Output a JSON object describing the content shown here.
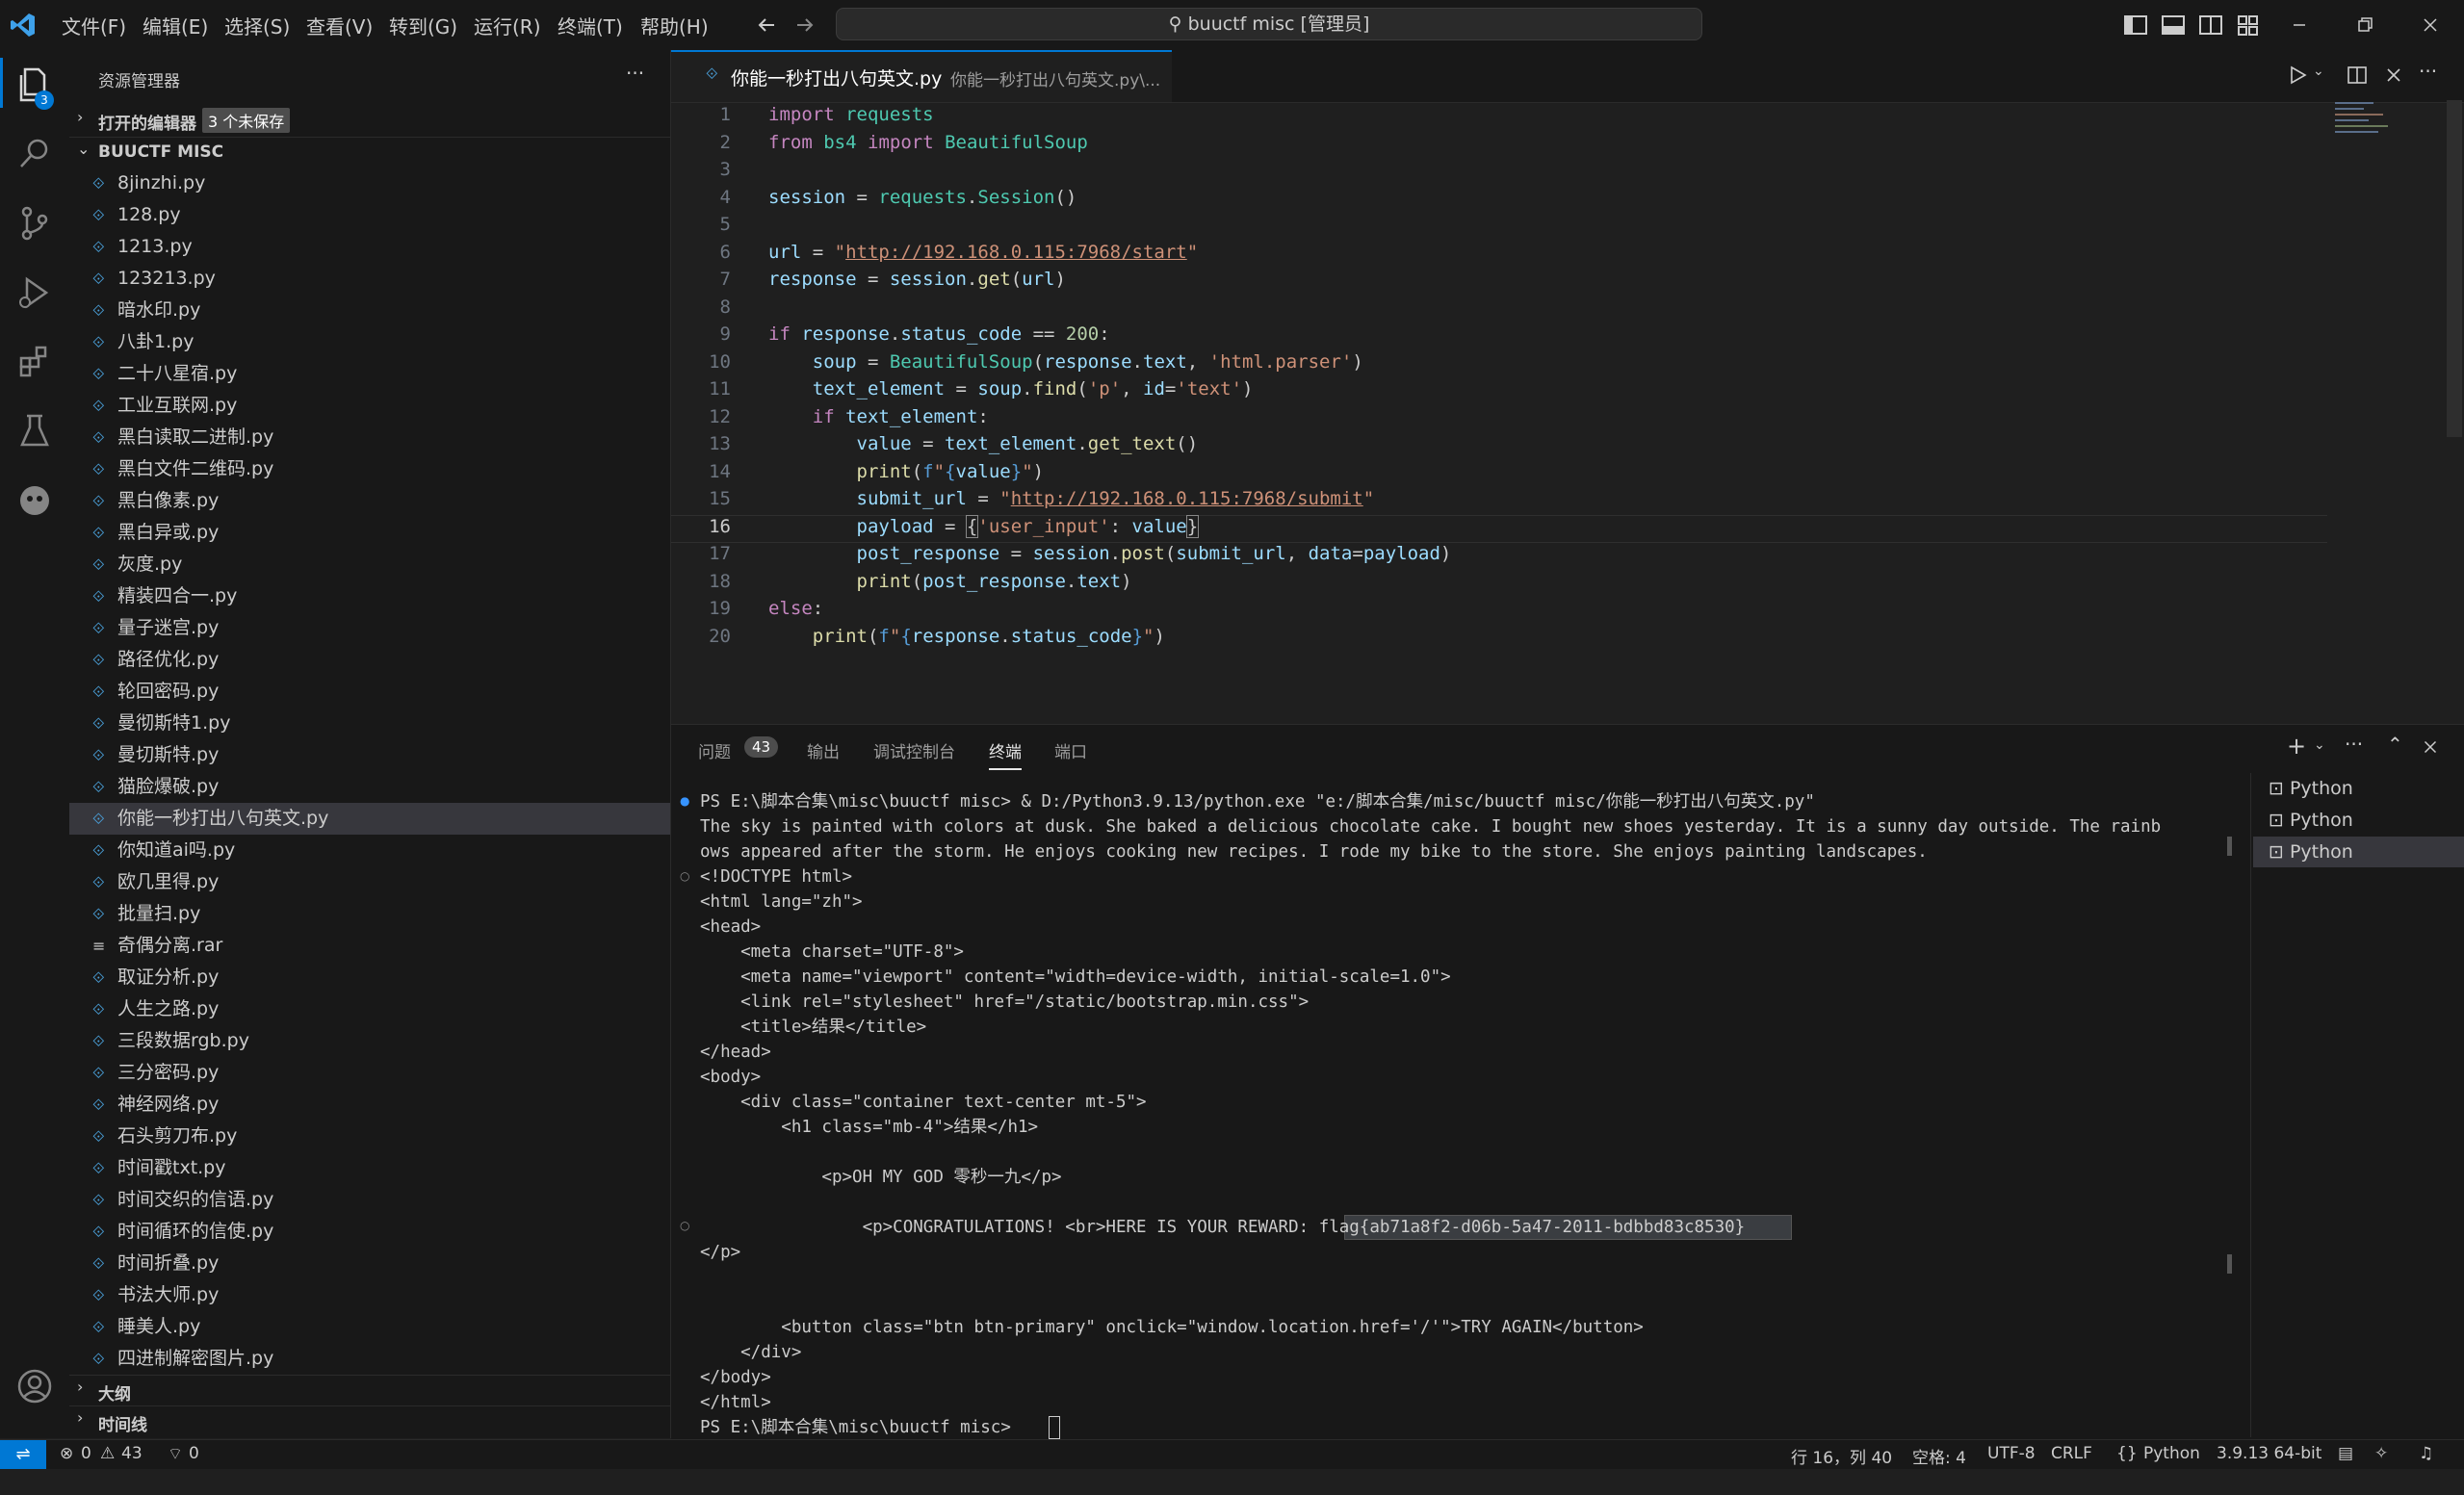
{
  "menu": [
    "文件(F)",
    "编辑(E)",
    "选择(S)",
    "查看(V)",
    "转到(G)",
    "运行(R)",
    "终端(T)",
    "帮助(H)"
  ],
  "search_box_text": "buuctf misc [管理员]",
  "activity_badge": "3",
  "sidebar": {
    "title": "资源管理器",
    "open_editors_label": "打开的编辑器",
    "open_editors_badge": "3 个未保存",
    "folder_name": "BUUCTF MISC",
    "files": [
      {
        "name": "8jinzhi.py",
        "icon": "py"
      },
      {
        "name": "128.py",
        "icon": "py"
      },
      {
        "name": "1213.py",
        "icon": "py"
      },
      {
        "name": "123213.py",
        "icon": "py"
      },
      {
        "name": "暗水印.py",
        "icon": "py"
      },
      {
        "name": "八卦1.py",
        "icon": "py"
      },
      {
        "name": "二十八星宿.py",
        "icon": "py"
      },
      {
        "name": "工业互联网.py",
        "icon": "py"
      },
      {
        "name": "黑白读取二进制.py",
        "icon": "py"
      },
      {
        "name": "黑白文件二维码.py",
        "icon": "py"
      },
      {
        "name": "黑白像素.py",
        "icon": "py"
      },
      {
        "name": "黑白异或.py",
        "icon": "py"
      },
      {
        "name": "灰度.py",
        "icon": "py"
      },
      {
        "name": "精装四合一.py",
        "icon": "py"
      },
      {
        "name": "量子迷宫.py",
        "icon": "py"
      },
      {
        "name": "路径优化.py",
        "icon": "py"
      },
      {
        "name": "轮回密码.py",
        "icon": "py"
      },
      {
        "name": "曼彻斯特1.py",
        "icon": "py"
      },
      {
        "name": "曼切斯特.py",
        "icon": "py"
      },
      {
        "name": "猫脸爆破.py",
        "icon": "py"
      },
      {
        "name": "你能一秒打出八句英文.py",
        "icon": "py"
      },
      {
        "name": "你知道ai吗.py",
        "icon": "py"
      },
      {
        "name": "欧几里得.py",
        "icon": "py"
      },
      {
        "name": "批量扫.py",
        "icon": "py"
      },
      {
        "name": "奇偶分离.rar",
        "icon": "rar"
      },
      {
        "name": "取证分析.py",
        "icon": "py"
      },
      {
        "name": "人生之路.py",
        "icon": "py"
      },
      {
        "name": "三段数据rgb.py",
        "icon": "py"
      },
      {
        "name": "三分密码.py",
        "icon": "py"
      },
      {
        "name": "神经网络.py",
        "icon": "py"
      },
      {
        "name": "石头剪刀布.py",
        "icon": "py"
      },
      {
        "name": "时间戳txt.py",
        "icon": "py"
      },
      {
        "name": "时间交织的信语.py",
        "icon": "py"
      },
      {
        "name": "时间循环的信使.py",
        "icon": "py"
      },
      {
        "name": "时间折叠.py",
        "icon": "py"
      },
      {
        "name": "书法大师.py",
        "icon": "py"
      },
      {
        "name": "睡美人.py",
        "icon": "py"
      },
      {
        "name": "四进制解密图片.py",
        "icon": "py"
      }
    ],
    "selected_file": "你能一秒打出八句英文.py",
    "outline_label": "大纲",
    "timeline_label": "时间线"
  },
  "editor": {
    "tab_title": "你能一秒打出八句英文.py",
    "breadcrumb": "你能一秒打出八句英文.py\\...",
    "current_line": "16",
    "line_numbers": [
      "1",
      "2",
      "3",
      "4",
      "5",
      "6",
      "7",
      "8",
      "9",
      "10",
      "11",
      "12",
      "13",
      "14",
      "15",
      "16",
      "17",
      "18",
      "19",
      "20"
    ]
  },
  "panel": {
    "tabs": [
      "问题",
      "输出",
      "调试控制台",
      "终端",
      "端口"
    ],
    "problems_count": "43",
    "active_tab": "终端",
    "terminal_lines": [
      "PS E:\\脚本合集\\misc\\buuctf misc> & D:/Python3.9.13/python.exe \"e:/脚本合集/misc/buuctf misc/你能一秒打出八句英文.py\"",
      "The sky is painted with colors at dusk. She baked a delicious chocolate cake. I bought new shoes yesterday. It is a sunny day outside. The rainb",
      "ows appeared after the storm. He enjoys cooking new recipes. I rode my bike to the store. She enjoys painting landscapes.",
      "<!DOCTYPE html>",
      "<html lang=\"zh\">",
      "<head>",
      "    <meta charset=\"UTF-8\">",
      "    <meta name=\"viewport\" content=\"width=device-width, initial-scale=1.0\">",
      "    <link rel=\"stylesheet\" href=\"/static/bootstrap.min.css\">",
      "    <title>结果</title>",
      "</head>",
      "<body>",
      "    <div class=\"container text-center mt-5\">",
      "        <h1 class=\"mb-4\">结果</h1>",
      "",
      "            <p>OH MY GOD 零秒一九</p>",
      "",
      "                <p>CONGRATULATIONS! <br>HERE IS YOUR REWARD: flag{ab71a8f2-d06b-5a47-2011-bdbbd83c8530}",
      "</p>",
      "",
      "",
      "        <button class=\"btn btn-primary\" onclick=\"window.location.href='/'\">TRY AGAIN</button>",
      "    </div>",
      "</body>",
      "</html>",
      "PS E:\\脚本合集\\misc\\buuctf misc> "
    ],
    "terminal_list": [
      "Python",
      "Python",
      "Python"
    ]
  },
  "statusbar": {
    "errors": "0",
    "warnings": "43",
    "ports": "0",
    "position": "行 16，列 40",
    "spaces": "空格: 4",
    "encoding": "UTF-8",
    "eol": "CRLF",
    "language": "Python",
    "interpreter": "3.9.13 64-bit"
  },
  "colors": {
    "accent": "#0078d4",
    "bg": "#1f1f1f",
    "sidebar": "#181818"
  }
}
